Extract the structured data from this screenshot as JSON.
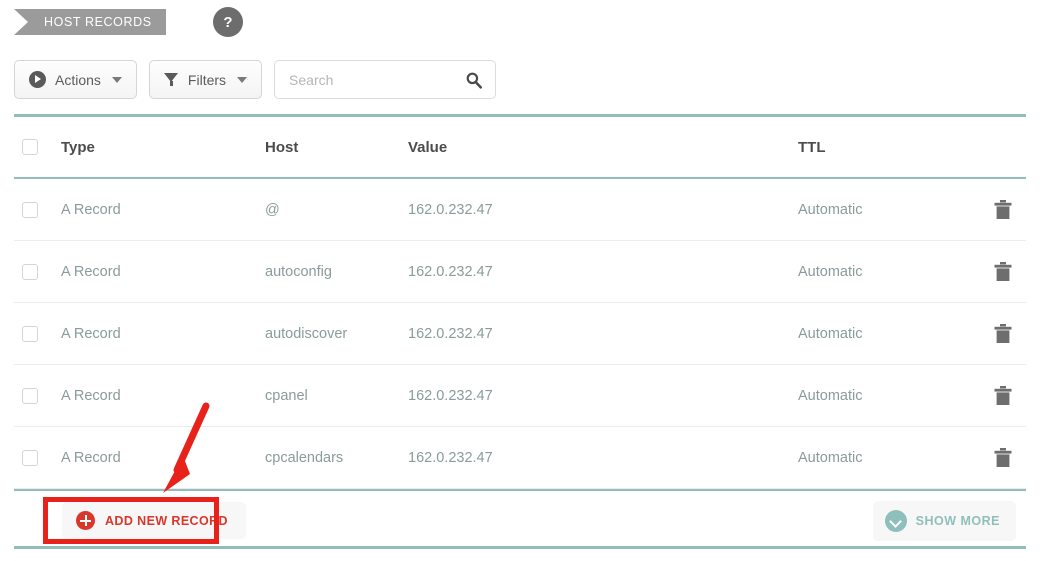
{
  "header": {
    "section_tab": "HOST RECORDS",
    "help_icon": "question-mark-icon",
    "help_label": "?"
  },
  "toolbar": {
    "actions_label": "Actions",
    "actions_icon": "play-circle-icon",
    "filters_label": "Filters",
    "filters_icon": "funnel-icon",
    "search_placeholder": "Search",
    "search_value": "",
    "search_icon": "magnifier-icon"
  },
  "table": {
    "columns": [
      "Type",
      "Host",
      "Value",
      "TTL"
    ],
    "rows": [
      {
        "type": "A Record",
        "host": "@",
        "value": "162.0.232.47",
        "ttl": "Automatic",
        "delete_icon": "trash-icon"
      },
      {
        "type": "A Record",
        "host": "autoconfig",
        "value": "162.0.232.47",
        "ttl": "Automatic",
        "delete_icon": "trash-icon"
      },
      {
        "type": "A Record",
        "host": "autodiscover",
        "value": "162.0.232.47",
        "ttl": "Automatic",
        "delete_icon": "trash-icon"
      },
      {
        "type": "A Record",
        "host": "cpanel",
        "value": "162.0.232.47",
        "ttl": "Automatic",
        "delete_icon": "trash-icon"
      },
      {
        "type": "A Record",
        "host": "cpcalendars",
        "value": "162.0.232.47",
        "ttl": "Automatic",
        "delete_icon": "trash-icon"
      }
    ]
  },
  "footer": {
    "add_label": "ADD NEW RECORD",
    "add_icon": "plus-circle-icon",
    "show_more_label": "SHOW MORE",
    "show_more_icon": "chevron-down-circle-icon"
  },
  "annotation": {
    "highlight_color": "#e8221b",
    "arrow_color": "#e8221b",
    "target": "ADD NEW RECORD"
  },
  "colors": {
    "tab_bg": "#9b9b9b",
    "teal_rule": "#93bcbc",
    "row_text": "#8a9b9b",
    "header_text": "#4c4c4c",
    "accent_red": "#d9372b",
    "accent_teal": "#8fbfbb"
  }
}
